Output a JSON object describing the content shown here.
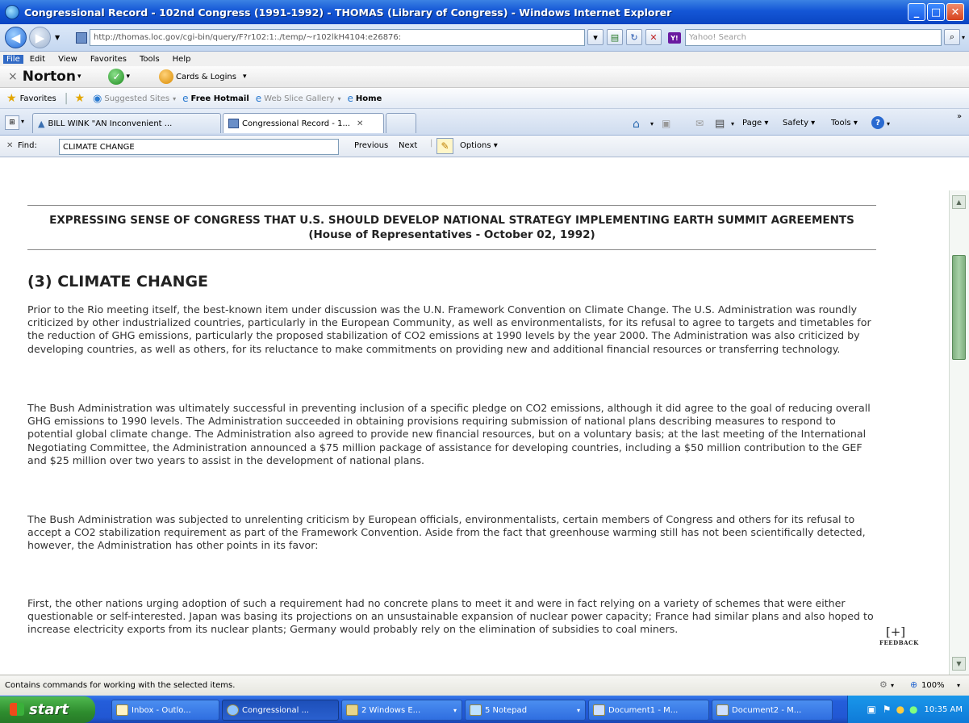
{
  "window": {
    "title": "Congressional Record - 102nd Congress (1991-1992) - THOMAS (Library of Congress) - Windows Internet Explorer"
  },
  "address_bar": {
    "url": "http://thomas.loc.gov/cgi-bin/query/F?r102:1:./temp/~r102lkH4104:e26876:",
    "search_placeholder": "Yahoo! Search"
  },
  "menu": {
    "items": [
      "File",
      "Edit",
      "View",
      "Favorites",
      "Tools",
      "Help"
    ]
  },
  "norton": {
    "brand": "Norton",
    "cards_label": "Cards & Logins"
  },
  "favorites_bar": {
    "favorites_label": "Favorites",
    "items": [
      "Suggested Sites",
      "Free Hotmail",
      "Web Slice Gallery",
      "Home"
    ]
  },
  "tabs": [
    {
      "label": "BILL WINK \"AN Inconvenient ..."
    },
    {
      "label": "Congressional Record - 1..."
    }
  ],
  "command_bar": {
    "items": [
      "Page",
      "Safety",
      "Tools"
    ]
  },
  "find_bar": {
    "label": "Find:",
    "query": "CLIMATE CHANGE",
    "previous": "Previous",
    "next": "Next",
    "options": "Options"
  },
  "document": {
    "heading": "EXPRESSING SENSE OF CONGRESS THAT U.S. SHOULD DEVELOP NATIONAL STRATEGY IMPLEMENTING EARTH SUMMIT AGREEMENTS (House of Representatives - October 02, 1992)",
    "section_title": "(3) CLIMATE CHANGE",
    "paragraphs": [
      "Prior to the Rio meeting itself, the best-known item under discussion was the U.N. Framework Convention on Climate Change. The U.S. Administration was roundly criticized by other industrialized countries, particularly in the European Community, as well as environmentalists, for its refusal to agree to targets and timetables for the reduction of GHG emissions, particularly the proposed stabilization of CO2 emissions at 1990 levels by the year 2000. The Administration was also criticized by developing countries, as well as others, for its reluctance to make commitments on providing new and additional financial resources or transferring technology.",
      "The Bush Administration was ultimately successful in preventing inclusion of a specific pledge on CO2 emissions, although it did agree to the goal of reducing overall GHG emissions to 1990 levels. The Administration succeeded in obtaining provisions requiring submission of national plans describing measures to respond to potential global climate change. The Administration also agreed to provide new financial resources, but on a voluntary basis; at the last meeting of the International Negotiating Committee, the Administration announced a $75 million package of assistance for developing countries, including a $50 million contribution to the GEF and $25 million over two years to assist in the development of national plans.",
      "The Bush Administration was subjected to unrelenting criticism by European officials, environmentalists, certain members of Congress and others for its refusal to accept a CO2 stabilization requirement as part of the Framework Convention. Aside from the fact that greenhouse warming still has not been scientifically detected, however, the Administration has other points in its favor:",
      "First, the other nations urging adoption of such a requirement had no concrete plans to meet it and were in fact relying on a variety of schemes that were either questionable or self-interested. Japan was basing its projections on an unsustainable expansion of nuclear power capacity; France had similar plans and also hoped to increase electricity exports from its nuclear plants; Germany would probably rely on the elimination of subsidies to coal miners."
    ],
    "feedback_plus": "[+]",
    "feedback_label": "FEEDBACK"
  },
  "status_bar": {
    "text": "Contains commands for working with the selected items.",
    "zoom": "100%"
  },
  "taskbar": {
    "start": "start",
    "buttons": [
      "Inbox - Outlo...",
      "Congressional ...",
      "2 Windows E...",
      "5 Notepad",
      "Document1 - M...",
      "Document2 - M..."
    ],
    "clock": "10:35 AM"
  },
  "colors": {
    "titlebar": "#1456d6",
    "taskbar": "#245edb",
    "start": "#2e8c2e"
  }
}
